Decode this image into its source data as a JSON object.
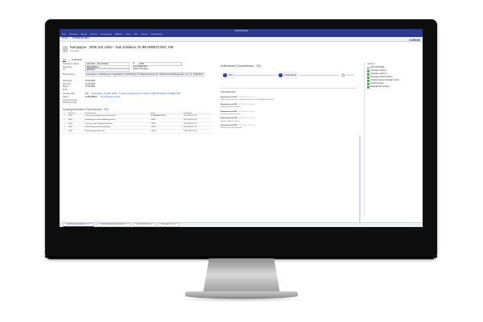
{
  "window": {
    "title": "CURSOR-CRM"
  },
  "menubar": [
    "Datei",
    "Bearbeiten",
    "Ansicht",
    "Favoriten",
    "Auswertungen",
    "Bibliothek",
    "Extras",
    "Hilfe",
    "Optionen",
    "Administration"
  ],
  "tabs": [
    {
      "label": "Verlauf",
      "active": false
    },
    {
      "label": "KT 3006 100 Jahre...",
      "active": true
    }
  ],
  "brand": "CURSOR",
  "header": {
    "title": "Kampagne : 3006 100 Jahre - Das Jubiläum; IN BEARBEITUNG; KM",
    "subtitle": "Kampagne"
  },
  "subtabs": [
    "Info",
    "Zusatzfelder"
  ],
  "fields": [
    {
      "label": "Kampagnen-Name",
      "value": "100 Jahre - Das Jubiläum",
      "extra": "ID",
      "extra_value": "3006"
    },
    {
      "label": "Zielgruppe",
      "value": "BESTANDKU",
      "extra": "Bestandskunden",
      "extra_value": ""
    },
    {
      "label": "Art",
      "value": "ANLASS",
      "extra": "Anlass Kampagne",
      "extra_value": ""
    },
    {
      "label": "Beschreibung",
      "value": "Kampagne zur Abbildung der Organisation, Durchführung und Nachbearbeitung der 'Jubiläums-Fortbildungswoche' vom 10.-15.09.2018",
      "extra": "",
      "extra_value": ""
    }
  ],
  "dates": [
    {
      "label": "Planbeginn",
      "value": "10.09.2018"
    },
    {
      "label": "Planende",
      "value": "30.09.2018"
    },
    {
      "label": "Beginn",
      "value": "10.09.2018"
    },
    {
      "label": "Ende",
      "value": ""
    }
  ],
  "contacts": [
    {
      "label": "Verantwortlich",
      "value": "KM",
      "detail": "Klaus Müller, +49 (641) 40000 · 0, klaus.mueller@cursor.de, Gießen, CURSOR GROUP, KUNDEN CRM"
    },
    {
      "label": "Status",
      "value": "IN BEARBEIT",
      "detail": "Die Kampagne ist aktiv"
    },
    {
      "label": "Kalenderanzeige",
      "value": "",
      "detail": ""
    },
    {
      "label": "Kalendereintrag",
      "value": "",
      "detail": ""
    }
  ],
  "stages_section": "Kampagnenphasen (Symbolboard - CB)",
  "stages_columns": [
    "Nummer",
    "Phasen-Name",
    "Status",
    "Planbeginn"
  ],
  "stages": [
    {
      "number": "3001",
      "name": "Planung und Selektion der Seminarthe...",
      "status": "IN BEARBEITUNG",
      "start": "10.01.2018 11:00"
    },
    {
      "number": "3002",
      "name": "Einladungsversand Fortbildungswoche",
      "status": "OPEN",
      "start": "10.01.2018 11:00"
    },
    {
      "number": "3003",
      "name": "Umsetzung der Werbemaßnahmen",
      "status": "OPEN",
      "start": "20.02.2018 11:00"
    },
    {
      "number": "3004",
      "name": "Durchführung der Veranstaltung",
      "status": "OPEN",
      "start": "22.03.2018 11:00"
    },
    {
      "number": "3005",
      "name": "Nachbefragung Besucher",
      "status": "OPEN",
      "start": "10.05.2018 11:00"
    }
  ],
  "center": {
    "title": "Multichannel (Symbolboard - CB)",
    "steps": [
      {
        "label": "Offen",
        "num": "1",
        "on": true
      },
      {
        "label": "In Bearbeitung",
        "num": "2",
        "on": true
      },
      {
        "label": "Erledigt",
        "num": "3",
        "on": false
      }
    ],
    "activity_title": "Aktivitätenliste",
    "entries": [
      {
        "author": "Kommentar von KM",
        "meta": "10.01.2018 11:00 | intern",
        "body": "Hallo, wir benötigen noch die Seminarthemen für die Fortbildungswoche."
      },
      {
        "author": "Kommentar von KM",
        "meta": "10.01.2018 11:00 | intern",
        "body": "Einladung wurde verschickt"
      },
      {
        "author": "Kommentar von KM",
        "meta": "10.01.2018 11:00 | intern",
        "body": "Locations wurden reserviert"
      },
      {
        "author": "Kommentar von KM",
        "meta": "10.01.2018 11:00 | intern",
        "body": "Räume wurden reserviert"
      },
      {
        "author": "Kommentar von KM",
        "meta": "10.01.2018 11:00 | intern",
        "body": "Hotelzimmer wurden gebucht"
      }
    ]
  },
  "right": {
    "title": "Aktionen",
    "items": [
      {
        "label": "MULTICHANNEL",
        "grey": true
      },
      {
        "label": "Kampagne kopieren",
        "grey": false
      },
      {
        "label": "Kampagne kopieren",
        "grey": false
      },
      {
        "label": "Kampagnenphase anlegen",
        "grey": false
      },
      {
        "label": "Vorgabe Dokumentvorlagen ändern",
        "grey": false
      },
      {
        "label": "Aktivität anlegen",
        "grey": false
      },
      {
        "label": "Budgetposition anlegen",
        "grey": false
      }
    ]
  },
  "taskbar": [
    {
      "label": "KAMPAGNENPHASEN / EX...",
      "on": true
    },
    {
      "label": "BEGLEITENDE AKTIVITÄTEN...",
      "on": false
    },
    {
      "label": "AKTIVITÄTEN (0)",
      "on": false
    },
    {
      "label": "BUDGETPOS. (0)",
      "on": false
    }
  ]
}
